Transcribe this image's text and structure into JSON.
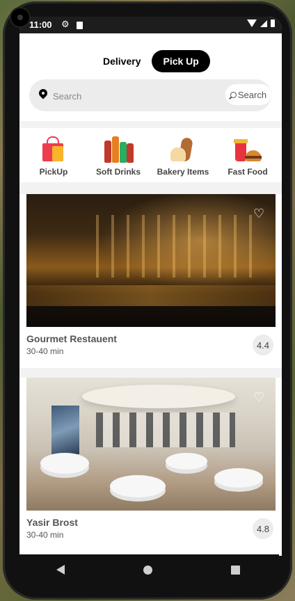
{
  "status_bar": {
    "time": "11:00"
  },
  "mode_toggle": {
    "delivery_label": "Delivery",
    "pickup_label": "Pick Up",
    "selected": "Pick Up"
  },
  "search": {
    "placeholder": "Search",
    "button_label": "Search"
  },
  "categories": [
    {
      "label": "PickUp",
      "icon": "shopping-bag-icon"
    },
    {
      "label": "Soft Drinks",
      "icon": "soda-bottles-icon"
    },
    {
      "label": "Bakery Items",
      "icon": "bread-icon"
    },
    {
      "label": "Fast Food",
      "icon": "burger-drink-icon"
    }
  ],
  "restaurants": [
    {
      "name": "Gourmet Restauent",
      "time": "30-40 min",
      "rating": "4.4"
    },
    {
      "name": "Yasir Brost",
      "time": "30-40 min",
      "rating": "4.8"
    }
  ],
  "colors": {
    "accent": "#000000",
    "background": "#f2f2f2",
    "card": "#ffffff"
  }
}
